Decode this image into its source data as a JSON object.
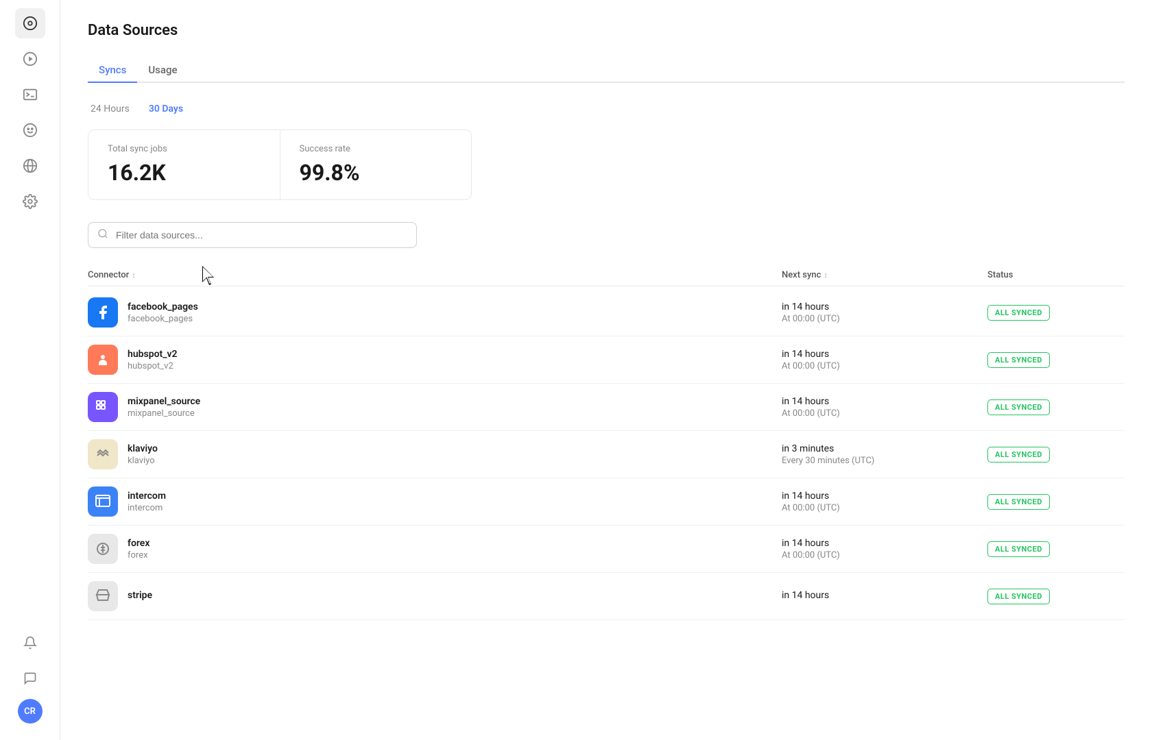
{
  "page": {
    "title": "Data Sources"
  },
  "sidebar": {
    "icons": [
      {
        "name": "home-icon",
        "symbol": "⊙",
        "active": true
      },
      {
        "name": "play-icon",
        "symbol": "▶",
        "active": false
      },
      {
        "name": "terminal-icon",
        "symbol": ">_",
        "active": false
      },
      {
        "name": "face-icon",
        "symbol": "☺",
        "active": false
      },
      {
        "name": "globe-icon",
        "symbol": "⊕",
        "active": false
      },
      {
        "name": "settings-icon",
        "symbol": "⚙",
        "active": false
      }
    ],
    "bottom_icons": [
      {
        "name": "bell-icon",
        "symbol": "🔔"
      },
      {
        "name": "chat-icon",
        "symbol": "💬"
      }
    ],
    "avatar": {
      "initials": "CR"
    }
  },
  "tabs": [
    {
      "label": "Syncs",
      "active": true
    },
    {
      "label": "Usage",
      "active": false
    }
  ],
  "time_filters": [
    {
      "label": "24 Hours",
      "active": false
    },
    {
      "label": "30 Days",
      "active": true
    }
  ],
  "stats": {
    "total_sync_jobs": {
      "label": "Total sync jobs",
      "value": "16.2K"
    },
    "success_rate": {
      "label": "Success rate",
      "value": "99.8%"
    }
  },
  "search": {
    "placeholder": "Filter data sources..."
  },
  "table": {
    "columns": {
      "connector": "Connector",
      "next_sync": "Next sync",
      "status": "Status"
    },
    "rows": [
      {
        "id": "facebook_pages",
        "name": "facebook_pages",
        "sub": "facebook_pages",
        "logo_type": "fb",
        "next_sync_time": "in 14 hours",
        "next_sync_utc": "At 00:00 (UTC)",
        "status": "ALL SYNCED"
      },
      {
        "id": "hubspot_v2",
        "name": "hubspot_v2",
        "sub": "hubspot_v2",
        "logo_type": "hs",
        "next_sync_time": "in 14 hours",
        "next_sync_utc": "At 00:00 (UTC)",
        "status": "ALL SYNCED"
      },
      {
        "id": "mixpanel_source",
        "name": "mixpanel_source",
        "sub": "mixpanel_source",
        "logo_type": "mp",
        "next_sync_time": "in 14 hours",
        "next_sync_utc": "At 00:00 (UTC)",
        "status": "ALL SYNCED"
      },
      {
        "id": "klaviyo",
        "name": "klaviyo",
        "sub": "klaviyo",
        "logo_type": "kl",
        "next_sync_time": "in 3 minutes",
        "next_sync_utc": "Every 30 minutes (UTC)",
        "status": "ALL SYNCED"
      },
      {
        "id": "intercom",
        "name": "intercom",
        "sub": "intercom",
        "logo_type": "ic",
        "next_sync_time": "in 14 hours",
        "next_sync_utc": "At 00:00 (UTC)",
        "status": "ALL SYNCED"
      },
      {
        "id": "forex",
        "name": "forex",
        "sub": "forex",
        "logo_type": "fx",
        "next_sync_time": "in 14 hours",
        "next_sync_utc": "At 00:00 (UTC)",
        "status": "ALL SYNCED"
      },
      {
        "id": "stripe",
        "name": "stripe",
        "sub": "",
        "logo_type": "st",
        "next_sync_time": "in 14 hours",
        "next_sync_utc": "",
        "status": "ALL SYNCED"
      }
    ]
  }
}
